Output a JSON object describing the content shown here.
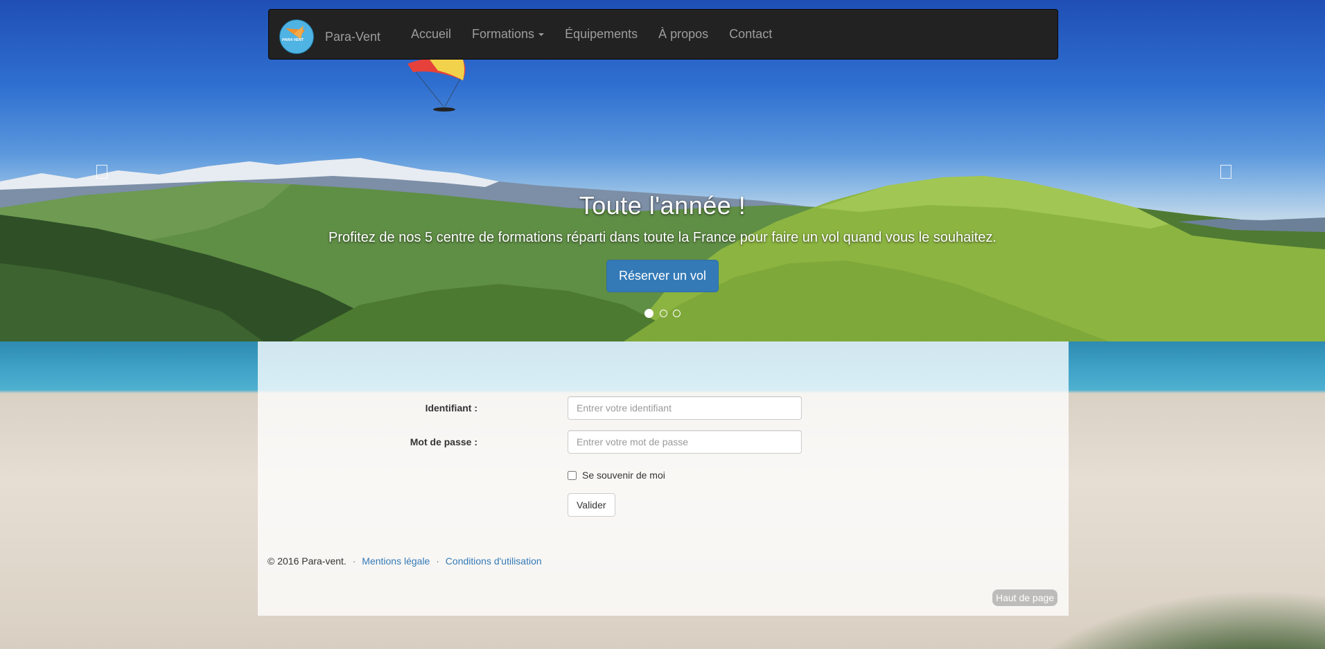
{
  "navbar": {
    "brand": "Para-Vent",
    "logo_text": "PARA VENT",
    "items": [
      {
        "label": "Accueil"
      },
      {
        "label": "Formations",
        "dropdown": true
      },
      {
        "label": "Équipements"
      },
      {
        "label": "À propos"
      },
      {
        "label": "Contact"
      }
    ]
  },
  "carousel": {
    "title": "Toute l'année !",
    "text": "Profitez de nos 5 centre de formations réparti dans toute la France pour faire un vol quand vous le souhaitez.",
    "button": "Réserver un vol",
    "slide_count": 3,
    "active_slide": 1
  },
  "login": {
    "username_label": "Identifiant :",
    "username_placeholder": "Entrer votre identifiant",
    "password_label": "Mot de passe :",
    "password_placeholder": "Entrer votre mot de passe",
    "remember_label": "Se souvenir de moi",
    "submit_label": "Valider"
  },
  "footer": {
    "copyright": "© 2016 Para-vent.",
    "separator": "·",
    "legal_link": "Mentions légale",
    "terms_link": "Conditions d'utilisation",
    "back_to_top": "Haut de page"
  },
  "colors": {
    "navbar_bg": "#222222",
    "nav_text": "#9d9d9d",
    "primary": "#337ab7",
    "link": "#337ab7"
  }
}
